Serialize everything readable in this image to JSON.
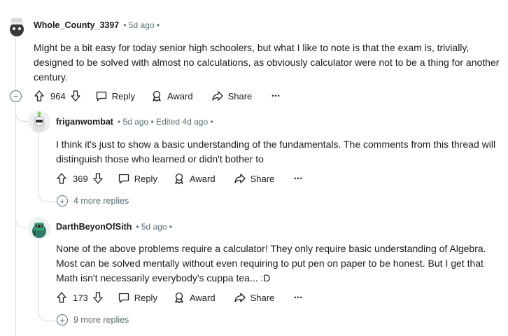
{
  "comments": [
    {
      "author": "Whole_County_3397",
      "meta": "• 5d ago •",
      "text": "Might be a bit easy for today senior high schoolers, but what I like to note is that the exam is, trivially, designed to be solved with almost no calculations, as obviously calculator were not to be a thing for another century.",
      "votes": "964",
      "reply_label": "Reply",
      "award_label": "Award",
      "share_label": "Share",
      "more_label": "•••"
    },
    {
      "author": "friganwombat",
      "meta": "• 5d ago • Edited 4d ago •",
      "text": "I think it's just to show a basic understanding of the fundamentals. The comments from this thread will distinguish those who learned or didn't bother to",
      "votes": "369",
      "reply_label": "Reply",
      "award_label": "Award",
      "share_label": "Share",
      "more_label": "•••",
      "more_replies": "4 more replies"
    },
    {
      "author": "DarthBeyonOfSith",
      "meta": "• 5d ago •",
      "text": "None of the above problems require a calculator! They only require basic understanding of Algebra. Most can be solved mentally without even requiring to put pen on paper to be honest. But I get that Math isn't necessarily everybody's cuppa tea... :D",
      "votes": "173",
      "reply_label": "Reply",
      "award_label": "Award",
      "share_label": "Share",
      "more_label": "•••",
      "more_replies": "9 more replies"
    }
  ],
  "collapse_symbol": "−",
  "expand_symbol": "+",
  "icons": [
    "upvote-icon",
    "downvote-icon",
    "reply-icon",
    "award-icon",
    "share-icon",
    "collapse-icon",
    "expand-icon"
  ]
}
